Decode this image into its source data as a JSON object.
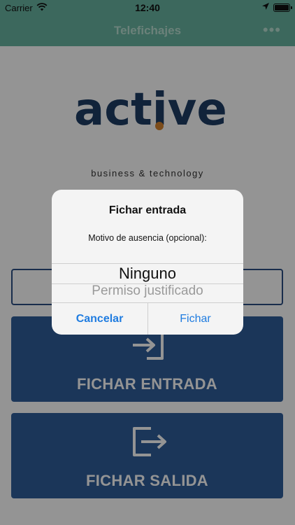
{
  "status_bar": {
    "carrier": "Carrier",
    "time": "12:40"
  },
  "nav": {
    "title": "Telefichajes",
    "more": "•••"
  },
  "logo": {
    "word": "active",
    "tagline": "business & technology",
    "text_color": "#1e3d64",
    "dot_color": "#d4832f"
  },
  "buttons": {
    "entrada": {
      "label": "FICHAR ENTRADA",
      "icon": "sign-in-icon"
    },
    "salida": {
      "label": "FICHAR SALIDA",
      "icon": "sign-out-icon"
    }
  },
  "dialog": {
    "title": "Fichar entrada",
    "message": "Motivo de ausencia (opcional):",
    "picker": {
      "selected": "Ninguno",
      "next": "Permiso justificado"
    },
    "cancel_label": "Cancelar",
    "confirm_label": "Fichar"
  },
  "colors": {
    "header": "#68b4a0",
    "button": "#2f5d9a",
    "link": "#1f7ce0"
  }
}
